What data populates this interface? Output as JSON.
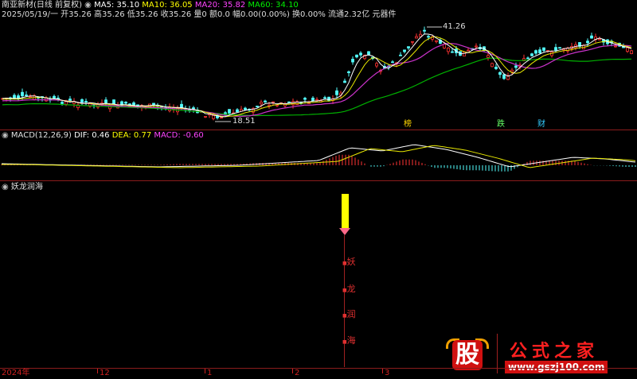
{
  "header": {
    "stock_name": "南亚新材(日线 前复权)",
    "ma5_label": "MA5: 35.10",
    "ma10_label": "MA10: 36.05",
    "ma20_label": "MA20: 35.82",
    "ma60_label": "MA60: 34.10",
    "quote_line": "2025/05/19/一 开35.26 高35.26 低35.26 收35.26 量0 额0.0 幅0.00(0.00%) 换0.00% 流通2.32亿 元器件"
  },
  "price_panel": {
    "high_label": "41.26",
    "low_label": "18.51",
    "markers": [
      "榜",
      "跌",
      "财"
    ],
    "colors": {
      "ma5": "#ffffff",
      "ma10": "#ffff00",
      "ma20": "#ff44ff",
      "ma60": "#00cc00",
      "up": "#ff3333",
      "down": "#54ffff"
    }
  },
  "macd_panel": {
    "title": "MACD(12,26,9)",
    "dif_label": "DIF: 0.46",
    "dea_label": "DEA: 0.77",
    "macd_label": "MACD: -0.60"
  },
  "indicator_panel": {
    "title": "妖龙润海",
    "chars": [
      "妖",
      "龙",
      "润",
      "海"
    ]
  },
  "time_axis": {
    "labels": [
      "2024年",
      "12",
      "1",
      "2",
      "3"
    ]
  },
  "watermark": {
    "logo_char": "股",
    "brand": "公式之家",
    "url": "www.gszj100.com"
  }
}
